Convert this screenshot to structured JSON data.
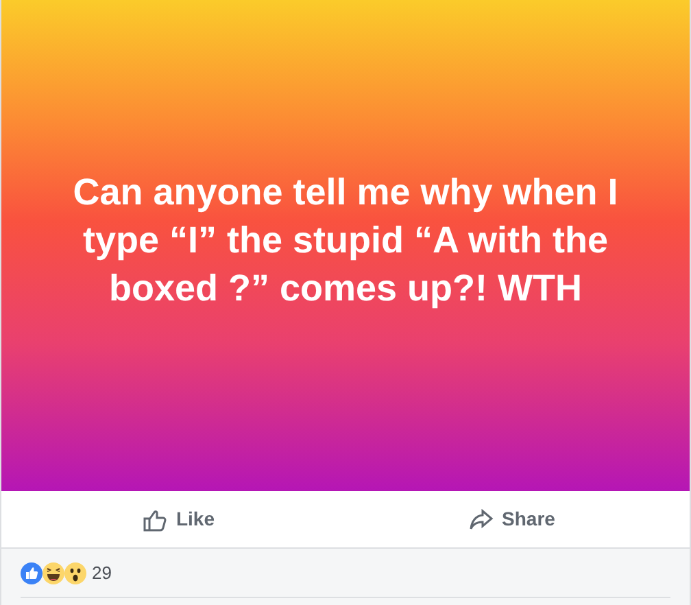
{
  "post": {
    "text": "Can anyone tell me why when I type “I” the stupid “A with the boxed ?” comes up?! WTH"
  },
  "actions": [
    {
      "kind": "like",
      "label": "Like"
    },
    {
      "kind": "share",
      "label": "Share"
    }
  ],
  "reactions": {
    "icons": [
      {
        "kind": "like"
      },
      {
        "kind": "haha"
      },
      {
        "kind": "wow"
      }
    ],
    "count": "29"
  }
}
